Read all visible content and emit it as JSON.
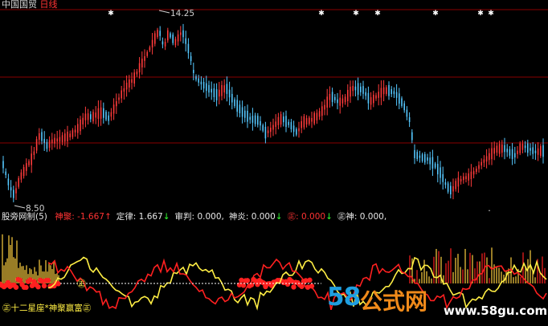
{
  "header": {
    "stock_name": "中国国贸",
    "period": "日线",
    "colors": {
      "stock_name": "#d8d8d8",
      "period": "#ff3333"
    }
  },
  "price_chart": {
    "high_label": "14.25",
    "low_label": "8.50",
    "colors": {
      "up": "#ff3b3b",
      "down": "#55c8ff",
      "grid": "#8a0000",
      "marker": "#ffffff"
    }
  },
  "indicator": {
    "name": "股旁网制(5)",
    "readouts": [
      {
        "label": "神聚",
        "sep": ": ",
        "value": "-1.667",
        "arrow": "↑",
        "color": "#ff3333",
        "arrow_color": "#ff3333"
      },
      {
        "label": "定律",
        "sep": ": ",
        "value": "1.667",
        "arrow": "↓",
        "color": "#e8e8e8",
        "arrow_color": "#33ff33"
      },
      {
        "label": "审判",
        "sep": ": ",
        "value": "0.000,",
        "arrow": "",
        "color": "#e8e8e8",
        "arrow_color": "#e8e8e8"
      },
      {
        "label": "神炎",
        "sep": ": ",
        "value": "0.000",
        "arrow": "↓",
        "color": "#e8e8e8",
        "arrow_color": "#33ff33"
      },
      {
        "label": "㊣",
        "sep": ": ",
        "value": "0.000",
        "arrow": "↓",
        "color": "#ff3333",
        "arrow_color": "#33ff33"
      },
      {
        "label": "㊣神",
        "sep": ": ",
        "value": "0.000,",
        "arrow": "",
        "color": "#e8e8e8",
        "arrow_color": "#e8e8e8"
      }
    ],
    "bottom_label": "㊣十二星座*神聚赢富㊣",
    "mid_marker": "㊣",
    "colors": {
      "line_a": "#ff2020",
      "line_b": "#ffee44",
      "spikes": "#ffd040",
      "band": "#ff2020"
    }
  },
  "watermark": {
    "digits": "58",
    "text": "公式网",
    "url": "www.58gu.com"
  }
}
